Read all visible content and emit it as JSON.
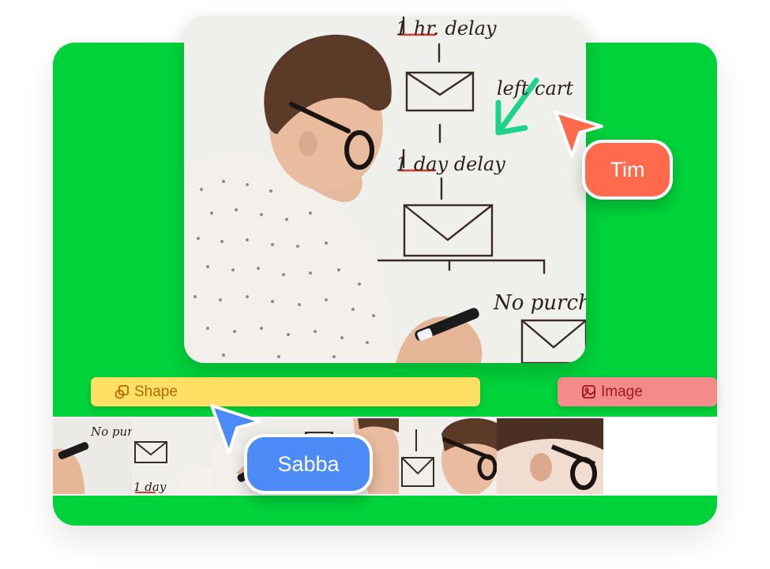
{
  "colors": {
    "canvas_green": "#00d33a",
    "shape_track": "#ffe065",
    "shape_text": "#b86a00",
    "image_track": "#f58a8a",
    "image_text": "#a11818",
    "tim_color": "#ff6a4d",
    "sabba_color": "#4c8bf5",
    "marker_arrow": "#1ed38a"
  },
  "hero": {
    "whiteboard_lines": [
      "1 hr. delay",
      "left cart",
      "1 day delay",
      "No purch"
    ]
  },
  "tracks": {
    "shape": {
      "label": "Shape",
      "icon": "shape-icon"
    },
    "image": {
      "label": "Image",
      "icon": "image-icon"
    }
  },
  "filmstrip": {
    "frame_texts": [
      "No purc",
      "1 day"
    ]
  },
  "collaborators": {
    "tim": {
      "name": "Tim",
      "icon": "cursor-arrow-icon"
    },
    "sabba": {
      "name": "Sabba",
      "icon": "cursor-arrow-icon"
    }
  }
}
